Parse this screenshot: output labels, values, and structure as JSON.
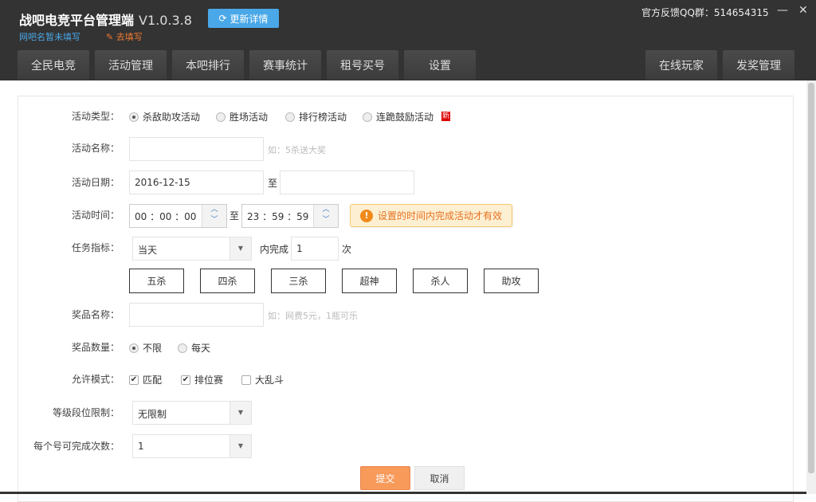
{
  "header": {
    "title": "战吧电竞平台管理端",
    "version": "V1.0.3.8",
    "update_label": "更新详情",
    "bar_name": "网吧名暂未填写",
    "fill_link": "去填写",
    "qq_group": "官方反馈QQ群：514654315",
    "minimize": "—",
    "close": "✕"
  },
  "tabs": [
    "全民电竞",
    "活动管理",
    "本吧排行",
    "赛事统计",
    "租号买号",
    "设置"
  ],
  "right_tabs": [
    "在线玩家",
    "发奖管理"
  ],
  "form": {
    "type_label": "活动类型：",
    "types": [
      "杀敌助攻活动",
      "胜场活动",
      "排行榜活动",
      "连跪鼓励活动"
    ],
    "new_badge": "新",
    "name_label": "活动名称：",
    "name_value": "",
    "name_hint": "如：5杀送大奖",
    "date_label": "活动日期：",
    "date_start": "2016-12-15",
    "to": "至",
    "date_end": "",
    "time_label": "活动时间：",
    "time_start": "00 ：00 ：00",
    "time_end": "23 ：59 ：59",
    "time_tip": "设置的时间内完成活动才有效",
    "task_label": "任务指标：",
    "task_period": "当天",
    "within": "内完成",
    "count": "1",
    "times": "次",
    "kill_types": [
      "五杀",
      "四杀",
      "三杀",
      "超神",
      "杀人",
      "助攻"
    ],
    "prize_label": "奖品名称：",
    "prize_value": "",
    "prize_hint": "如：网费5元，1瓶可乐",
    "qty_label": "奖品数量：",
    "qty_options": [
      "不限",
      "每天"
    ],
    "mode_label": "允许模式：",
    "modes": [
      {
        "label": "匹配",
        "checked": true
      },
      {
        "label": "排位赛",
        "checked": true
      },
      {
        "label": "大乱斗",
        "checked": false
      }
    ],
    "rank_label": "等级段位限制：",
    "rank_value": "无限制",
    "per_label": "每个号可完成次数：",
    "per_value": "1",
    "submit": "提交",
    "cancel": "取消"
  }
}
